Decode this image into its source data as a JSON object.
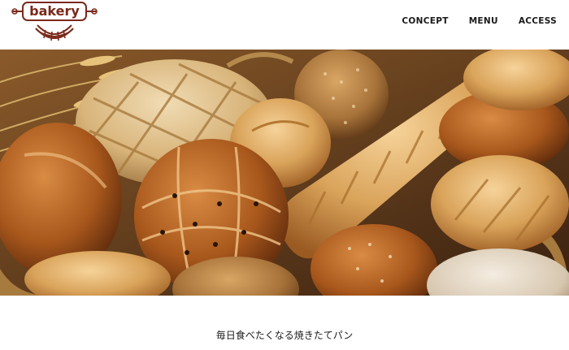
{
  "logo": {
    "text": "bakery",
    "icon": "croissant-icon",
    "color": "#7a2a1a"
  },
  "nav": {
    "items": [
      {
        "label": "CONCEPT"
      },
      {
        "label": "MENU"
      },
      {
        "label": "ACCESS"
      }
    ]
  },
  "hero": {
    "image": "bread-assortment-photo"
  },
  "tagline": "毎日食べたくなる焼きたてパン"
}
